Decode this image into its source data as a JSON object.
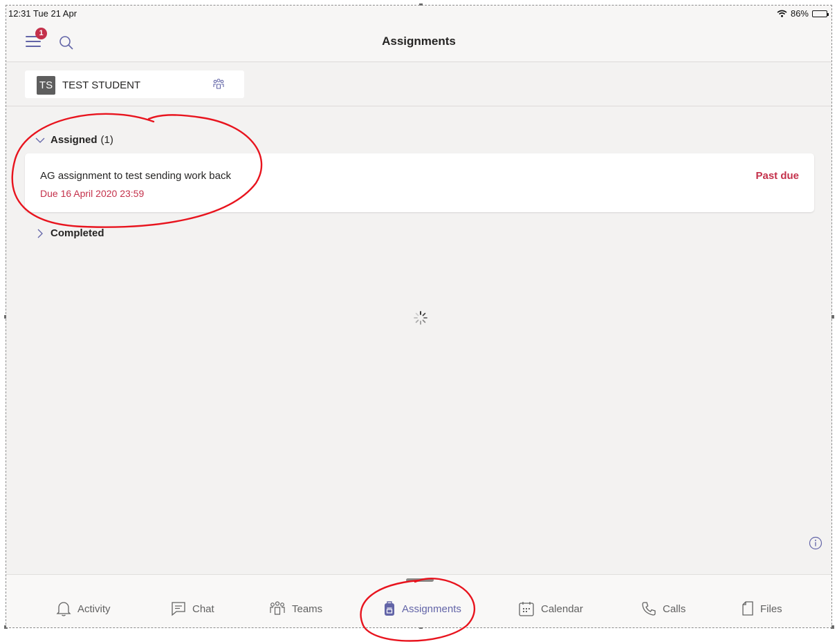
{
  "status_bar": {
    "time": "12:31  Tue 21 Apr",
    "battery": "86%"
  },
  "header": {
    "title": "Assignments",
    "notification_count": "1"
  },
  "class_selector": {
    "initials": "TS",
    "name": "TEST STUDENT"
  },
  "sections": {
    "assigned": {
      "label": "Assigned",
      "count": "(1)"
    },
    "completed": {
      "label": "Completed"
    }
  },
  "assignments": [
    {
      "name": "AG assignment to test sending work back",
      "due": "Due 16 April 2020 23:59",
      "status": "Past due"
    }
  ],
  "tabs": {
    "activity": "Activity",
    "chat": "Chat",
    "teams": "Teams",
    "assignments": "Assignments",
    "calendar": "Calendar",
    "calls": "Calls",
    "files": "Files"
  },
  "colors": {
    "accent": "#6264a7",
    "alert": "#c4314b",
    "annotation": "#e8141e"
  }
}
